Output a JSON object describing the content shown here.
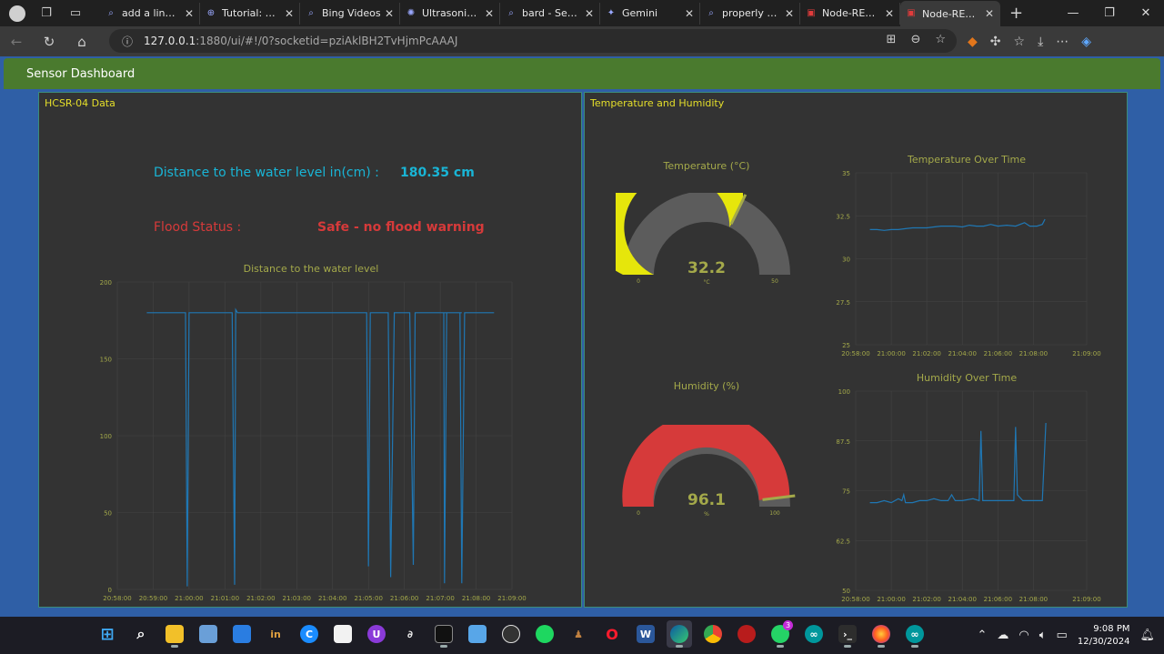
{
  "browser": {
    "tabs": [
      {
        "label": "add a line ch",
        "icon": "search-icon"
      },
      {
        "label": "Tutorial: Nod",
        "icon": "globe-icon"
      },
      {
        "label": "Bing Videos",
        "icon": "search-icon"
      },
      {
        "label": "Ultrasonic Se",
        "icon": "chatgpt-icon"
      },
      {
        "label": "bard - Search",
        "icon": "search-icon"
      },
      {
        "label": "Gemini",
        "icon": "gemini-icon"
      },
      {
        "label": "properly cust",
        "icon": "search-icon"
      },
      {
        "label": "Node-RED : I",
        "icon": "node-red-icon"
      },
      {
        "label": "Node-RED D",
        "icon": "node-red-icon",
        "active": true
      }
    ],
    "url_host": "127.0.0.1",
    "url_rest": ":1880/ui/#!/0?socketid=pziAklBH2TvHjmPcAAAJ"
  },
  "dashboard": {
    "title": "Sensor Dashboard",
    "hcsr_group": {
      "title": "HCSR-04 Data",
      "distance_label": "Distance to the water level in(cm) :",
      "distance_value": "180.35 cm",
      "flood_label": "Flood Status :",
      "flood_value": "Safe - no flood warning"
    },
    "temp_group": {
      "title": "Temperature and Humidity",
      "temp_gauge_title": "Temperature (°C)",
      "temp_value_text": "32.2",
      "temp_unit": "°C",
      "temp_min": "0",
      "temp_max": "50",
      "temp_color": "#e6e60b",
      "hum_gauge_title": "Humidity (%)",
      "hum_value_text": "96.1",
      "hum_unit": "%",
      "hum_min": "0",
      "hum_max": "100",
      "hum_color": "#d63a3a"
    }
  },
  "chart_data": [
    {
      "type": "line",
      "title": "Distance to the water level",
      "x": [
        "20:58:00",
        "20:59:00",
        "21:00:00",
        "21:01:00",
        "21:02:00",
        "21:03:00",
        "21:04:00",
        "21:05:00",
        "21:06:00",
        "21:07:00",
        "21:08:00",
        "21:09:00"
      ],
      "ylim": [
        0,
        200
      ],
      "yticks": [
        "0",
        "50",
        "100",
        "150",
        "200"
      ],
      "series": [
        {
          "color": "#1f77b4",
          "points": [
            [
              0.82,
              180
            ],
            [
              1.5,
              180
            ],
            [
              1.9,
              180
            ],
            [
              1.95,
              2
            ],
            [
              2.0,
              180
            ],
            [
              3.2,
              180
            ],
            [
              3.27,
              3
            ],
            [
              3.3,
              182
            ],
            [
              3.35,
              180
            ],
            [
              6.5,
              180
            ],
            [
              6.95,
              180
            ],
            [
              7.0,
              15
            ],
            [
              7.05,
              180
            ],
            [
              7.55,
              180
            ],
            [
              7.62,
              8
            ],
            [
              7.72,
              180
            ],
            [
              8.15,
              180
            ],
            [
              8.25,
              16
            ],
            [
              8.3,
              180
            ],
            [
              9.6,
              180
            ],
            [
              9.1,
              180
            ],
            [
              9.12,
              4
            ],
            [
              9.18,
              180
            ],
            [
              9.55,
              180
            ],
            [
              9.6,
              4
            ],
            [
              9.68,
              180
            ],
            [
              10.5,
              180
            ]
          ]
        }
      ]
    },
    {
      "type": "gauge",
      "title": "Temperature (°C)",
      "value": 32.2,
      "min": 0,
      "max": 50
    },
    {
      "type": "line",
      "title": "Temperature Over Time",
      "x": [
        "20:58:00",
        "21:00:00",
        "21:02:00",
        "21:04:00",
        "21:06:00",
        "21:08:00"
      ],
      "xlast": "21:09:00",
      "ylim": [
        25,
        35
      ],
      "yticks": [
        "25",
        "27.5",
        "30",
        "32.5",
        "35"
      ],
      "series": [
        {
          "color": "#1f77b4",
          "points": [
            [
              0.8,
              31.7
            ],
            [
              1.2,
              31.7
            ],
            [
              1.6,
              31.65
            ],
            [
              2.0,
              31.7
            ],
            [
              2.4,
              31.7
            ],
            [
              2.8,
              31.75
            ],
            [
              3.2,
              31.8
            ],
            [
              3.6,
              31.8
            ],
            [
              4.0,
              31.8
            ],
            [
              4.4,
              31.85
            ],
            [
              4.8,
              31.9
            ],
            [
              5.2,
              31.9
            ],
            [
              5.6,
              31.9
            ],
            [
              6.0,
              31.85
            ],
            [
              6.4,
              31.95
            ],
            [
              6.8,
              31.9
            ],
            [
              7.2,
              31.9
            ],
            [
              7.6,
              32.0
            ],
            [
              8.0,
              31.9
            ],
            [
              8.5,
              31.95
            ],
            [
              9.0,
              31.9
            ],
            [
              9.5,
              32.1
            ],
            [
              9.8,
              31.9
            ],
            [
              10.2,
              31.9
            ],
            [
              10.5,
              32.0
            ],
            [
              10.65,
              32.3
            ]
          ]
        }
      ]
    },
    {
      "type": "gauge",
      "title": "Humidity (%)",
      "value": 96.1,
      "min": 0,
      "max": 100
    },
    {
      "type": "line",
      "title": "Humidity Over Time",
      "x": [
        "20:58:00",
        "21:00:00",
        "21:02:00",
        "21:04:00",
        "21:06:00",
        "21:08:00"
      ],
      "xlast": "21:09:00",
      "ylim": [
        50,
        100
      ],
      "yticks": [
        "50",
        "62.5",
        "75",
        "87.5",
        "100"
      ],
      "series": [
        {
          "color": "#1f77b4",
          "points": [
            [
              0.8,
              72
            ],
            [
              1.2,
              72
            ],
            [
              1.6,
              72.5
            ],
            [
              2.0,
              72
            ],
            [
              2.4,
              73
            ],
            [
              2.6,
              72.5
            ],
            [
              2.7,
              74
            ],
            [
              2.8,
              72
            ],
            [
              3.2,
              72
            ],
            [
              3.6,
              72.5
            ],
            [
              4.0,
              72.5
            ],
            [
              4.4,
              73
            ],
            [
              4.8,
              72.5
            ],
            [
              5.2,
              72.5
            ],
            [
              5.4,
              74
            ],
            [
              5.6,
              72.5
            ],
            [
              6.0,
              72.5
            ],
            [
              6.6,
              73
            ],
            [
              6.95,
              72.5
            ],
            [
              7.05,
              90
            ],
            [
              7.15,
              72.5
            ],
            [
              7.4,
              72.5
            ],
            [
              7.8,
              72.5
            ],
            [
              8.2,
              72.5
            ],
            [
              8.9,
              72.5
            ],
            [
              9.0,
              91
            ],
            [
              9.1,
              74
            ],
            [
              9.4,
              72.5
            ],
            [
              9.8,
              72.5
            ],
            [
              10.2,
              72.5
            ],
            [
              10.5,
              72.5
            ],
            [
              10.7,
              92
            ]
          ]
        }
      ]
    }
  ],
  "taskbar": {
    "time": "9:08 PM",
    "date": "12/30/2024",
    "whatsapp_badge": "3"
  }
}
